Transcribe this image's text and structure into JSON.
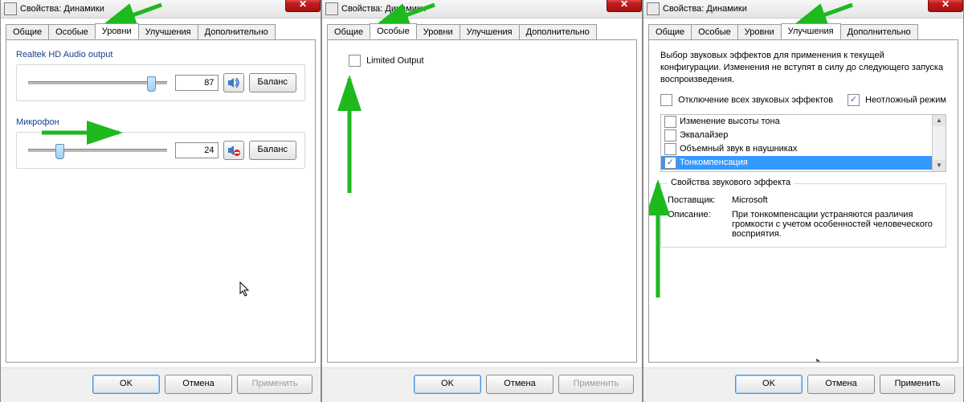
{
  "window_title": "Свойства: Динамики",
  "tabs": {
    "general": "Общие",
    "custom": "Особые",
    "levels": "Уровни",
    "enhancements": "Улучшения",
    "advanced": "Дополнительно"
  },
  "buttons": {
    "ok": "OK",
    "cancel": "Отмена",
    "apply": "Применить",
    "balance": "Баланс"
  },
  "levels": {
    "output_label": "Realtek HD Audio output",
    "output_value": "87",
    "mic_label": "Микрофон",
    "mic_value": "24"
  },
  "custom": {
    "limited_output": "Limited Output"
  },
  "enhancements": {
    "intro": "Выбор звуковых эффектов для применения к текущей конфигурации. Изменения не вступят в силу до следующего запуска воспроизведения.",
    "disable_all": "Отключение всех звуковых эффектов",
    "immediate_mode": "Неотложный режим",
    "items": {
      "pitch": "Изменение высоты тона",
      "equalizer": "Эквалайзер",
      "headphone_virt": "Объемный звук в наушниках",
      "loudness": "Тонкомпенсация"
    },
    "props_legend": "Свойства звукового эффекта",
    "provider_label": "Поставщик:",
    "provider_value": "Microsoft",
    "desc_label": "Описание:",
    "desc_value": "При тонкомпенсации устраняются различия громкости с учетом особенностей человеческого восприятия."
  }
}
